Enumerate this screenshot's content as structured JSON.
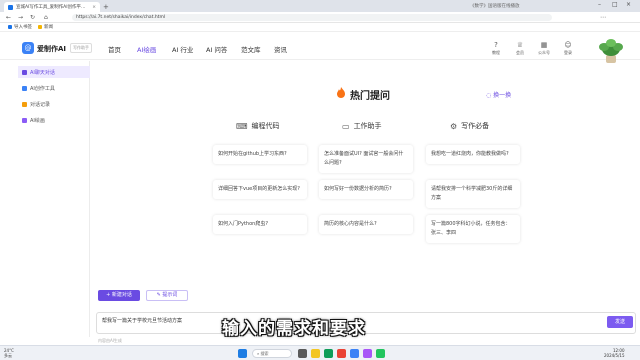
{
  "browser": {
    "tab_active": "宣城AI写作工具_爱制作AI创作平...",
    "tab_second": "《数学》国语版在线播放",
    "url": "https://ai.7t.net/shaikai/index/chat.html",
    "bookmarks": [
      {
        "label": "导入书签",
        "color": "#1a73e8"
      },
      {
        "label": "新闻",
        "color": "#f4b400"
      }
    ]
  },
  "site": {
    "brand": "爱制作AI",
    "brand_tag": "写作助手",
    "nav": [
      {
        "label": "首页",
        "active": false
      },
      {
        "label": "AI绘画",
        "active": true
      },
      {
        "label": "AI 行业",
        "active": false
      },
      {
        "label": "AI 问答",
        "active": false
      },
      {
        "label": "范文库",
        "active": false
      },
      {
        "label": "资讯",
        "active": false
      }
    ],
    "header_icons": [
      {
        "label": "教程",
        "icon": "question-icon"
      },
      {
        "label": "会员",
        "icon": "crown-icon"
      },
      {
        "label": "公众号",
        "icon": "qr-icon"
      },
      {
        "label": "登录",
        "icon": "user-icon"
      }
    ]
  },
  "sidebar": {
    "items": [
      {
        "label": "AI聊天对话",
        "active": true,
        "color": "#6a4be2"
      },
      {
        "label": "AI创作工具",
        "active": false,
        "color": "#3b82f6"
      },
      {
        "label": "对话记录",
        "active": false,
        "color": "#f59e0b"
      },
      {
        "label": "AI绘画",
        "active": false,
        "color": "#8b5cf6"
      }
    ]
  },
  "main": {
    "hot_title": "热门提问",
    "refresh_label": "换一换",
    "columns": [
      {
        "title": "编程代码",
        "icon": "code-icon",
        "questions": [
          "如何开始在github上学习东西?",
          "详细回答下vue项目的更新怎么实现?",
          "如何入门Python爬虫?"
        ]
      },
      {
        "title": "工作助手",
        "icon": "monitor-icon",
        "questions": [
          "怎么准备面试UI? 面试官一般会问什么问题?",
          "如何写好一份数据分析的简历?",
          "简历的核心内容是什么?"
        ]
      },
      {
        "title": "写作必备",
        "icon": "gear-icon",
        "questions": [
          "我想吃一道红烧肉，你能教我做吗?",
          "请帮我安排一个科学减肥30斤的详细方案",
          "写一篇800字科幻小说，任务包含：张三、李四"
        ]
      }
    ],
    "new_chat_label": "新建对话",
    "prompt_lib_label": "提示词",
    "input_value": "帮我写一篇关于学校元旦节活动方案",
    "send_label": "发送",
    "footnote": "内容由AI生成",
    "subtitle": "输入的需求和要求"
  },
  "taskbar": {
    "weather_temp": "24°C",
    "weather_desc": "多云",
    "search_label": "搜索",
    "time": "12:00",
    "date": "2024/5/15"
  },
  "colors": {
    "accent": "#6a4be2",
    "fire": "#f97316"
  }
}
